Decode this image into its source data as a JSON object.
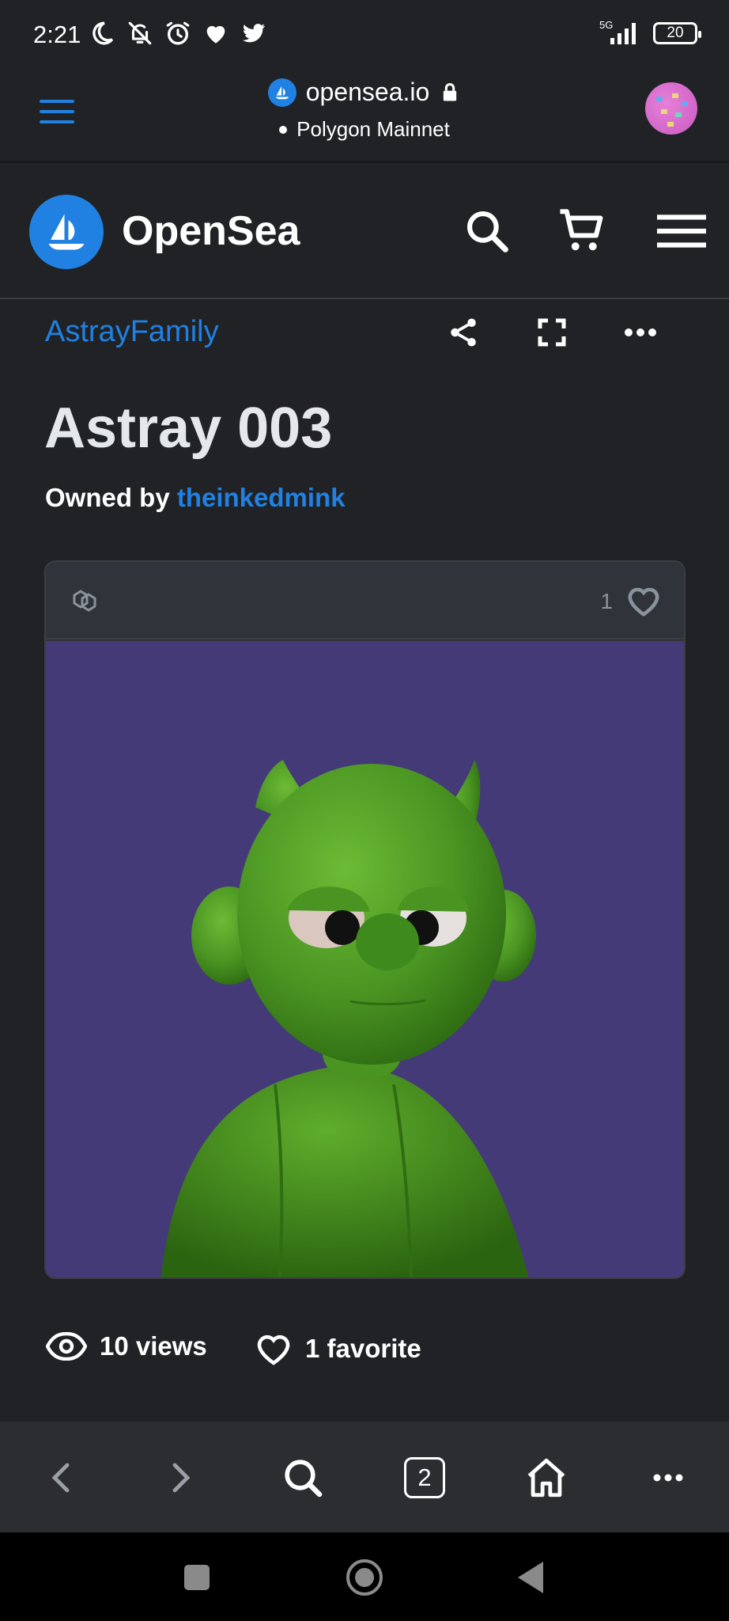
{
  "status_bar": {
    "time": "2:21",
    "network_label": "5G",
    "battery": "20",
    "icons": [
      "moon-icon",
      "bell-off-icon",
      "alarm-icon",
      "heart-icon",
      "twitter-icon",
      "signal-icon",
      "battery-icon"
    ]
  },
  "browser": {
    "url": "opensea.io",
    "network": "Polygon Mainnet",
    "tabs_count": "2"
  },
  "header": {
    "brand": "OpenSea",
    "icons": [
      "search-icon",
      "cart-icon",
      "menu-icon"
    ]
  },
  "item": {
    "collection": "AstrayFamily",
    "title": "Astray 003",
    "owned_by_label": "Owned by",
    "owner": "theinkedmink",
    "favorite_count": "1",
    "views": "10 views",
    "favorites": "1 favorite"
  },
  "colors": {
    "accent": "#2081e2",
    "background": "#202225",
    "card": "#303339",
    "art_background": "#443a78",
    "character": "#4f9a23"
  }
}
